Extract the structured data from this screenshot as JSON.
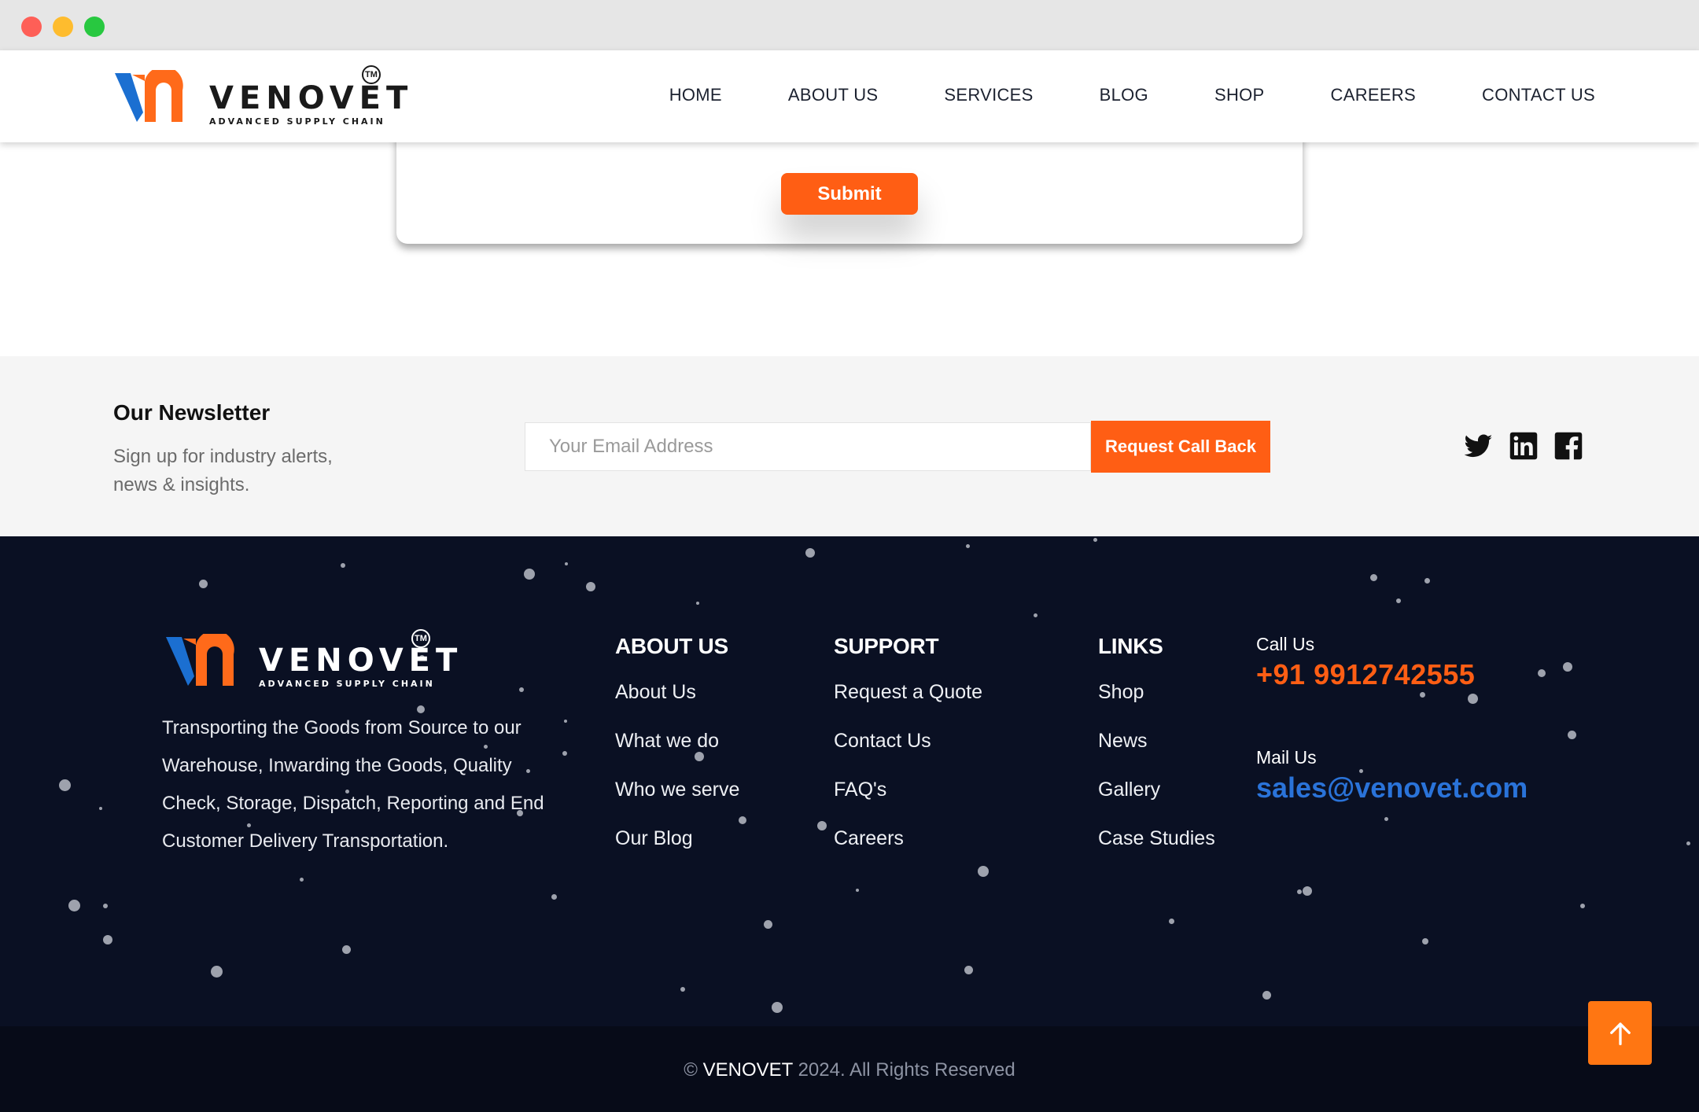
{
  "brand": {
    "name": "VENOVET",
    "tagline": "ADVANCED SUPPLY CHAIN",
    "trademark": "TM",
    "colors": {
      "orange": "#ff5e14",
      "blue": "#2a73d9",
      "dark": "#0a1023"
    }
  },
  "nav": {
    "items": [
      {
        "label": "HOME"
      },
      {
        "label": "ABOUT US"
      },
      {
        "label": "SERVICES"
      },
      {
        "label": "BLOG"
      },
      {
        "label": "SHOP"
      },
      {
        "label": "CAREERS"
      },
      {
        "label": "CONTACT US"
      }
    ]
  },
  "form": {
    "submit_label": "Submit"
  },
  "newsletter": {
    "title": "Our Newsletter",
    "subtitle": "Sign up for industry alerts, news & insights.",
    "email_placeholder": "Your Email Address",
    "button_label": "Request Call Back",
    "social_icons": [
      "twitter-icon",
      "linkedin-icon",
      "facebook-icon"
    ]
  },
  "footer": {
    "description": "Transporting the Goods from Source to our Warehouse, Inwarding the Goods, Quality Check, Storage, Dispatch, Reporting and End Customer Delivery Transportation.",
    "columns": [
      {
        "title": "ABOUT US",
        "links": [
          "About Us",
          "What we do",
          "Who we serve",
          "Our Blog"
        ]
      },
      {
        "title": "SUPPORT",
        "links": [
          "Request a Quote",
          "Contact Us",
          "FAQ's",
          "Careers"
        ]
      },
      {
        "title": "LINKS",
        "links": [
          "Shop",
          "News",
          "Gallery",
          "Case Studies"
        ]
      }
    ],
    "call_label": "Call Us",
    "phone": "+91 9912742555",
    "mail_label": "Mail Us",
    "email": "sales@venovet.com"
  },
  "copyright": {
    "symbol": "©",
    "brand": "VENOVET",
    "text": "2024. All Rights Reserved"
  },
  "back_to_top_icon": "arrow-up-icon"
}
